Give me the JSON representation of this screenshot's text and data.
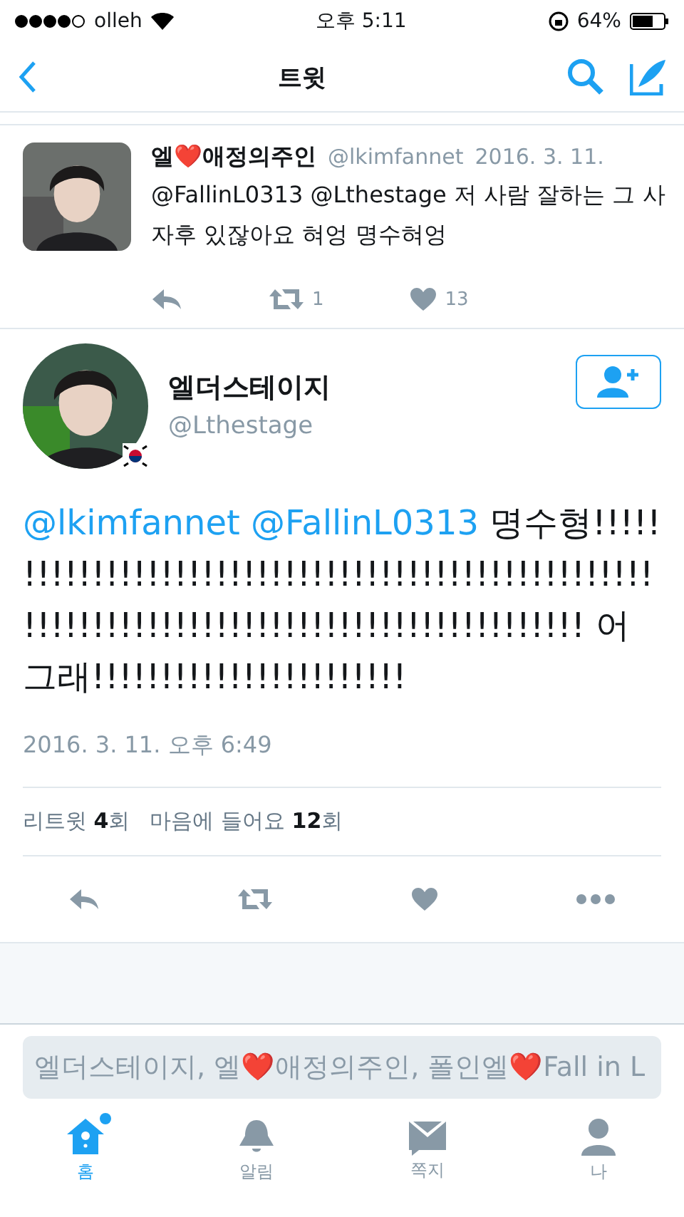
{
  "status_bar": {
    "carrier": "olleh",
    "time": "오후 5:11",
    "battery": "64%"
  },
  "nav": {
    "title": "트윗"
  },
  "parent_tweet": {
    "name": "엘❤️애정의주인",
    "handle": "@lkimfannet",
    "date": "2016. 3. 11.",
    "text": "@FallinL0313 @Lthestage 저 사람 잘하는 그 사자후 있잖아요 혀엉 명수혀엉",
    "retweets": "1",
    "likes": "13"
  },
  "tweet": {
    "name": "엘더스테이지",
    "handle": "@Lthestage",
    "parts": [
      {
        "kind": "mention",
        "text": "@lkimfannet"
      },
      {
        "kind": "mention",
        "text": "@FallinL0313"
      },
      {
        "kind": "plain",
        "text": "명수형!!!!!!!!!!!!!!!!!!!!!!!!!!!!!!!!!!!!!!!!!!!!!!!!!!!!!!!!!!!!!!!!!!!!!!!!!!!!!!!!!!!!!!!!!!!! 어그래!!!!!!!!!!!!!!!!!!!!!!!"
      }
    ],
    "date": "2016. 3. 11. 오후 6:49",
    "retweet_stat": "리트윗 **4**회",
    "like_stat": "마음에 들어요 **12**회"
  },
  "reply": {
    "placeholder": "엘더스테이지, 엘❤️애정의주인, 폴인엘❤️Fall in L"
  },
  "tabs": [
    {
      "label": "홈",
      "kind": "home",
      "selected": true,
      "badge": true
    },
    {
      "label": "알림",
      "kind": "bell",
      "selected": false,
      "badge": false
    },
    {
      "label": "쪽지",
      "kind": "mail",
      "selected": false,
      "badge": false
    },
    {
      "label": "나",
      "kind": "person",
      "selected": false,
      "badge": false
    }
  ]
}
